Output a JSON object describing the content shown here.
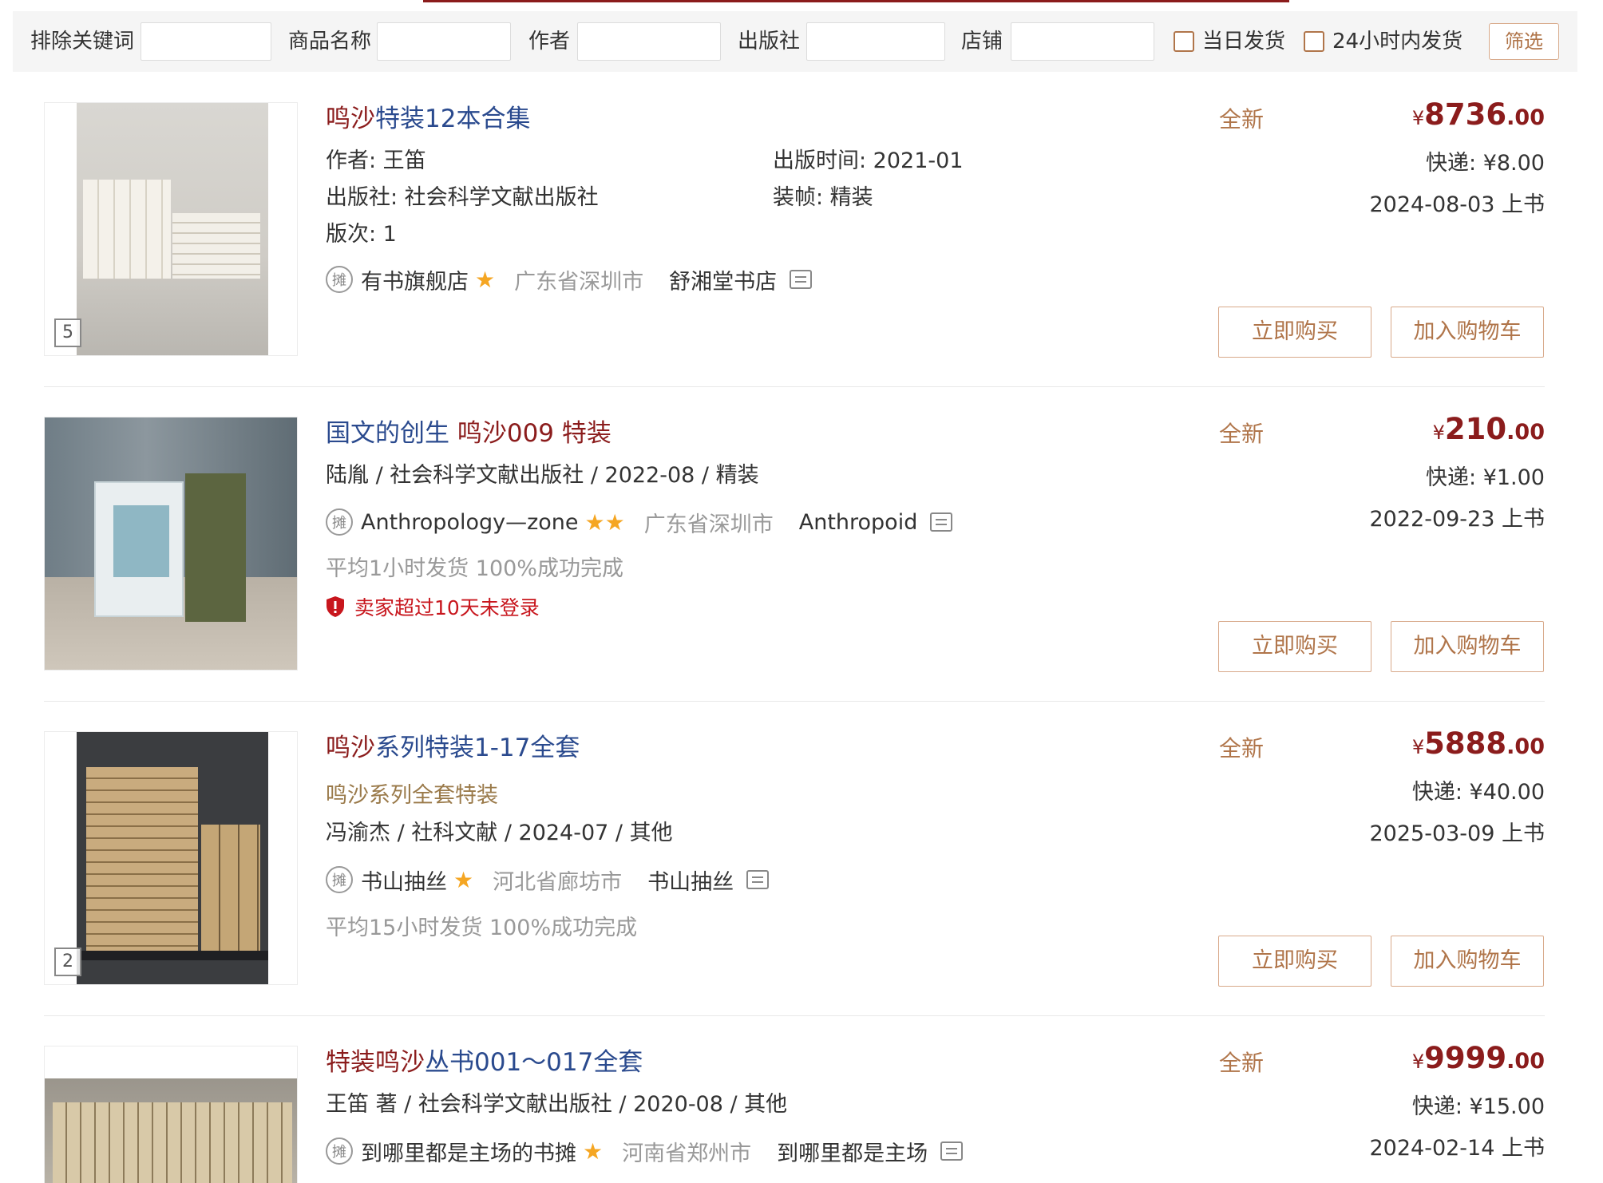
{
  "filters": {
    "exclude_keyword_label": "排除关键词",
    "product_name_label": "商品名称",
    "author_label": "作者",
    "publisher_label": "出版社",
    "shop_label": "店铺",
    "same_day_label": "当日发货",
    "within_24h_label": "24小时内发货",
    "filter_button": "筛选"
  },
  "labels": {
    "stall_badge": "摊",
    "buy_now": "立即购买",
    "add_to_cart": "加入购物车",
    "star": "★",
    "star2": "★★"
  },
  "items": [
    {
      "title_hl": "鸣沙",
      "title_rest": "特装12本合集",
      "author": "作者: 王笛",
      "pub_time": "出版时间: 2021-01",
      "publisher": "出版社: 社会科学文献出版社",
      "binding": "装帧: 精装",
      "edition": "版次: 1",
      "shop": "有书旗舰店",
      "location": "广东省深圳市",
      "store_name": "舒湘堂书店",
      "condition": "全新",
      "price_symbol": "¥",
      "price_int": "8736",
      "price_dec": ".00",
      "shipping": "快递: ¥8.00",
      "listed": "2024-08-03 上书",
      "image_count": "5"
    },
    {
      "title_pre": "国文的创生 ",
      "title_hl": "鸣沙",
      "title_rest": "009 特装",
      "meta": "陆胤 / 社会科学文献出版社 / 2022-08 / 精装",
      "shop": "Anthropology—zone",
      "location": "广东省深圳市",
      "store_name": "Anthropoid",
      "stats": "平均1小时发货  100%成功完成",
      "warning": "卖家超过10天未登录",
      "condition": "全新",
      "price_symbol": "¥",
      "price_int": "210",
      "price_dec": ".00",
      "shipping": "快递: ¥1.00",
      "listed": "2022-09-23 上书"
    },
    {
      "title_hl": "鸣沙",
      "title_rest": "系列特装1-17全套",
      "subtitle": "鸣沙系列全套特装",
      "meta": "冯渝杰 / 社科文献 / 2024-07 / 其他",
      "shop": "书山抽丝",
      "location": "河北省廊坊市",
      "store_name": "书山抽丝",
      "stats": "平均15小时发货  100%成功完成",
      "condition": "全新",
      "price_symbol": "¥",
      "price_int": "5888",
      "price_dec": ".00",
      "shipping": "快递: ¥40.00",
      "listed": "2025-03-09 上书",
      "image_count": "2"
    },
    {
      "title_hl": "特装鸣沙",
      "title_rest": "丛书001～017全套",
      "meta": "王笛 著 / 社会科学文献出版社 / 2020-08 / 其他",
      "shop": "到哪里都是主场的书摊",
      "location": "河南省郑州市",
      "store_name": "到哪里都是主场",
      "condition": "全新",
      "price_symbol": "¥",
      "price_int": "9999",
      "price_dec": ".00",
      "shipping": "快递: ¥15.00",
      "listed": "2024-02-14 上书"
    }
  ]
}
